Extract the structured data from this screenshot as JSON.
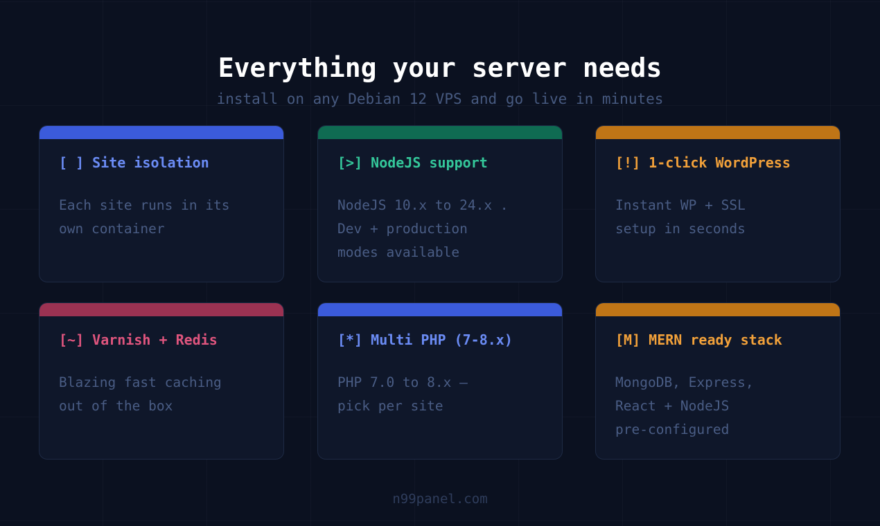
{
  "header": {
    "title": "Everything your server needs",
    "subtitle": "install on any Debian 12 VPS and go live in minutes"
  },
  "colors": {
    "background": "#0b1120",
    "card_background": "#0f172a",
    "blue": "#3b5bdb",
    "green": "#0f6b52",
    "orange": "#c07516",
    "rose": "#9b3252",
    "blue_text": "#6b8cf5",
    "green_text": "#34c79a",
    "orange_text": "#f2a13a",
    "rose_text": "#e0557e",
    "description_text": "#4a5d85"
  },
  "cards": [
    {
      "icon": "[ ]",
      "title": "Site isolation",
      "lines": [
        "Each site runs in its",
        "own container"
      ]
    },
    {
      "icon": "[>]",
      "title": "NodeJS support",
      "lines": [
        "NodeJS 10.x to 24.x .",
        "Dev + production",
        "modes available"
      ]
    },
    {
      "icon": "[!]",
      "title": "1-click WordPress",
      "lines": [
        "Instant WP + SSL",
        "setup in seconds"
      ]
    },
    {
      "icon": "[~]",
      "title": "Varnish + Redis",
      "lines": [
        "Blazing fast caching",
        "out of the box"
      ]
    },
    {
      "icon": "[*]",
      "title": "Multi PHP (7-8.x)",
      "lines": [
        "PHP 7.0 to 8.x —",
        "pick per site"
      ]
    },
    {
      "icon": "[M]",
      "title": "MERN ready stack",
      "lines": [
        "MongoDB, Express,",
        "React + NodeJS",
        "pre-configured"
      ]
    }
  ],
  "footer": {
    "url": "n99panel.com"
  }
}
